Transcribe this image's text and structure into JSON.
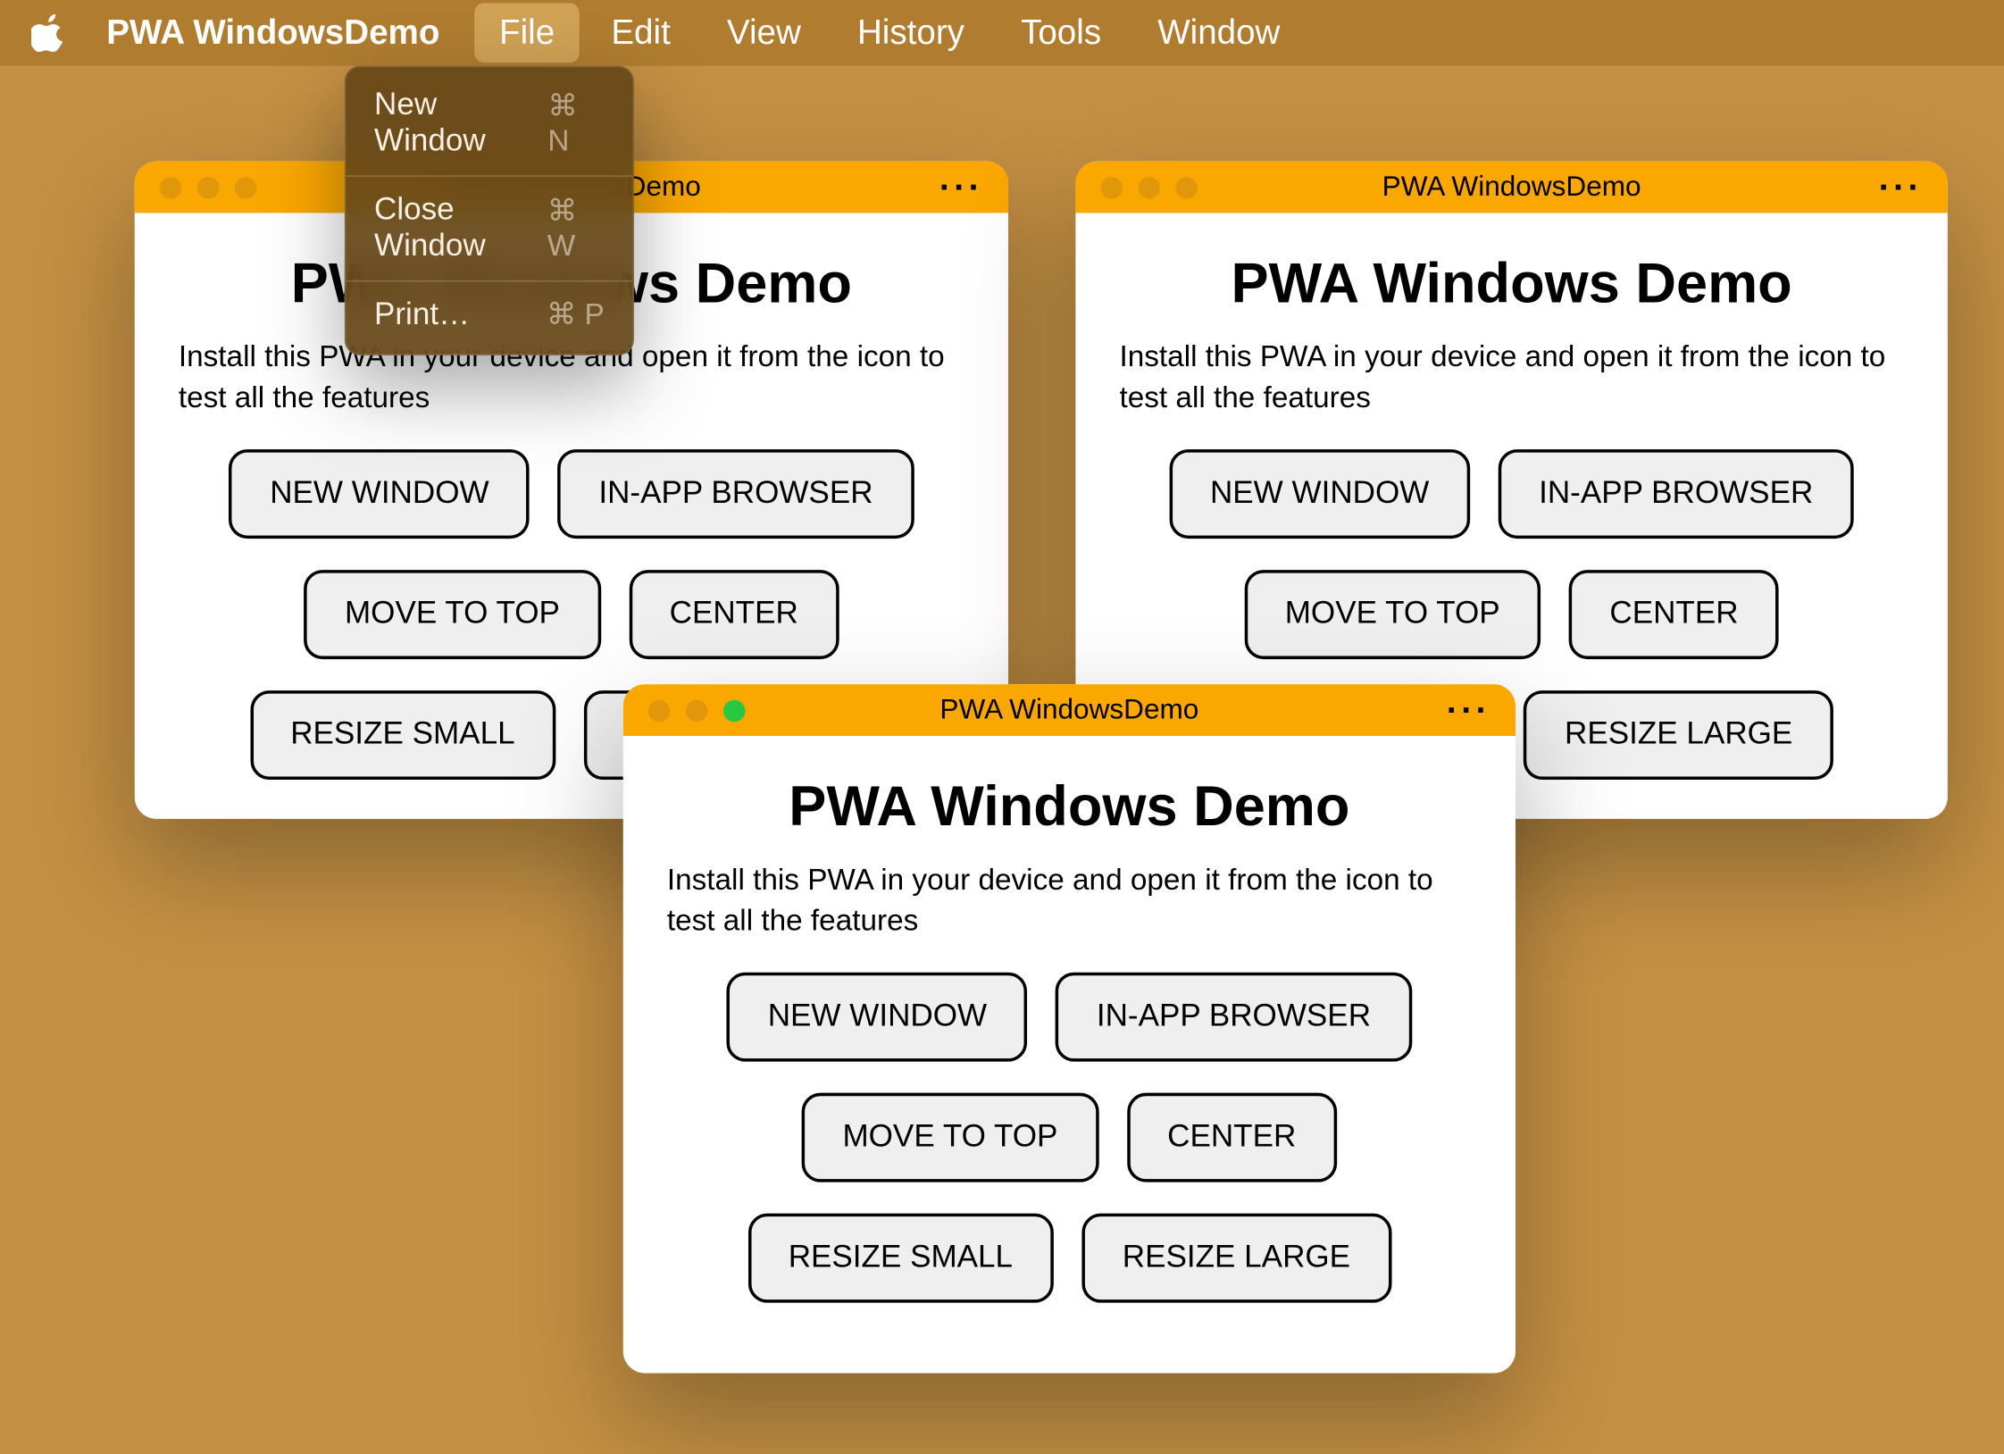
{
  "menubar": {
    "app_name": "PWA WindowsDemo",
    "items": [
      "File",
      "Edit",
      "View",
      "History",
      "Tools",
      "Window"
    ],
    "active_menu": "File"
  },
  "file_menu": {
    "items": [
      {
        "label": "New Window",
        "shortcut": "⌘ N"
      },
      {
        "label": "Close Window",
        "shortcut": "⌘ W"
      },
      {
        "label": "Print…",
        "shortcut": "⌘ P"
      }
    ]
  },
  "window": {
    "title": "PWA WindowsDemo",
    "more": "···",
    "heading": "PWA Windows Demo",
    "description": "Install this PWA in your device and open it from the icon to test all the features",
    "buttons": {
      "new_window": "NEW WINDOW",
      "in_app_browser": "IN-APP BROWSER",
      "move_to_top": "MOVE TO TOP",
      "center": "CENTER",
      "resize_small": "RESIZE SMALL",
      "resize_large": "RESIZE LARGE"
    }
  }
}
